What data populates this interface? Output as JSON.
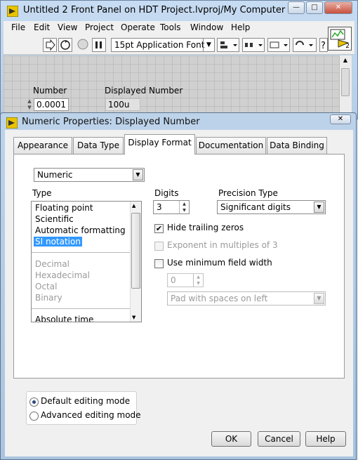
{
  "main_window": {
    "title": "Untitled 2 Front Panel on HDT Project.lvproj/My Computer *",
    "caption_buttons": [
      "—",
      "□",
      "✕"
    ],
    "menu": [
      "File",
      "Edit",
      "View",
      "Project",
      "Operate",
      "Tools",
      "Window",
      "Help"
    ],
    "toolbar": {
      "font": "15pt Application Font"
    },
    "vi_icon_badge": "2",
    "controls": {
      "number": {
        "label": "Number",
        "value": "0.0001"
      },
      "displayed_number": {
        "label": "Displayed Number",
        "value": "100u"
      }
    }
  },
  "dialog": {
    "title": "Numeric Properties: Displayed Number",
    "close_glyph": "✕",
    "tabs": [
      "Appearance",
      "Data Type",
      "Display Format",
      "Documentation",
      "Data Binding"
    ],
    "active_tab": "Display Format",
    "format_mode": "Numeric",
    "type_label": "Type",
    "type_items": [
      "Floating point",
      "Scientific",
      "Automatic formatting",
      "SI notation"
    ],
    "type_items_disabled": [
      "Decimal",
      "Hexadecimal",
      "Octal",
      "Binary"
    ],
    "type_items_more": "Absolute time",
    "selected_type": "SI notation",
    "digits_label": "Digits",
    "digits_value": "3",
    "precision_label": "Precision Type",
    "precision_value": "Significant digits",
    "hide_trailing_zeros": {
      "label": "Hide trailing zeros",
      "checked": true
    },
    "exponent_multiples": {
      "label": "Exponent in multiples of 3",
      "checked": false,
      "enabled": false
    },
    "min_field_width": {
      "label": "Use minimum field width",
      "checked": false
    },
    "min_width_value": "0",
    "pad_value": "Pad with spaces on left",
    "editing_modes": [
      "Default editing mode",
      "Advanced editing mode"
    ],
    "selected_mode": "Default editing mode",
    "buttons": {
      "ok": "OK",
      "cancel": "Cancel",
      "help": "Help"
    }
  }
}
